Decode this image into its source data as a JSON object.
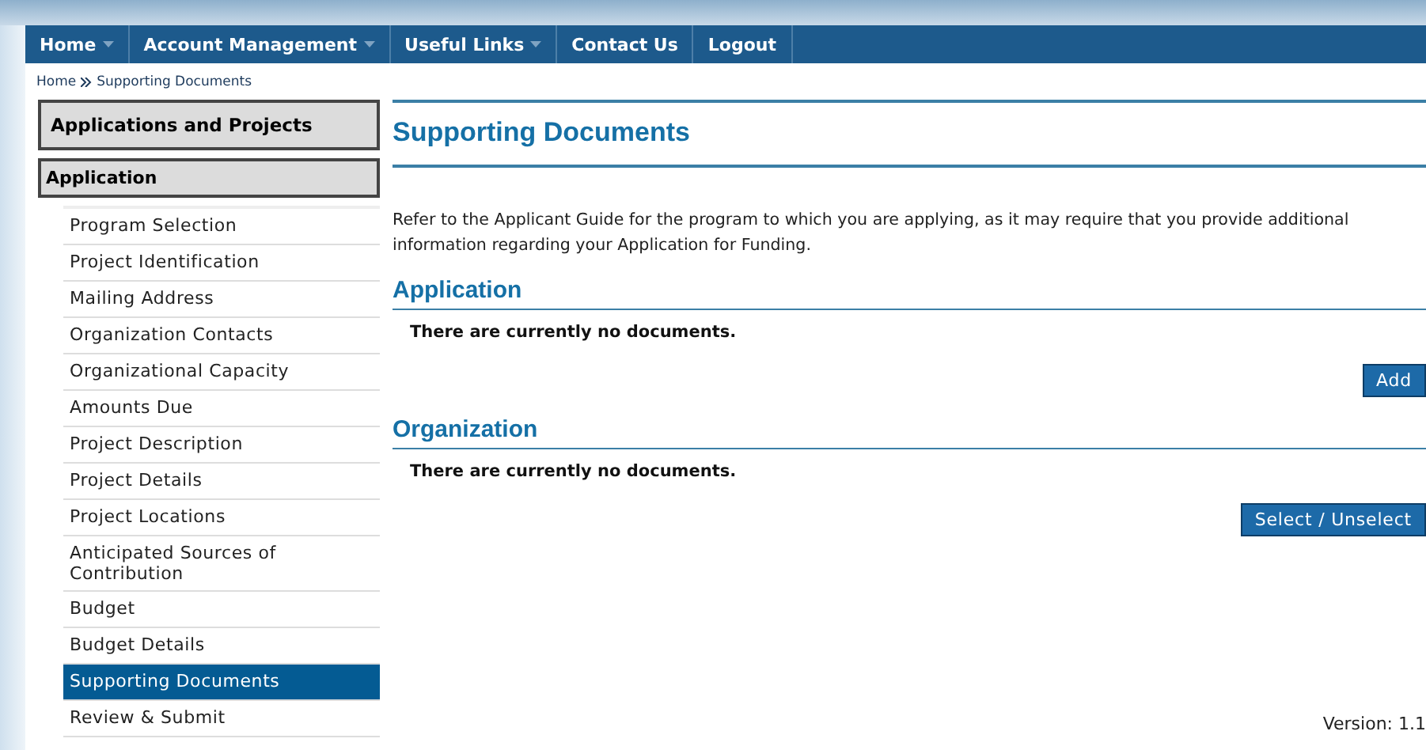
{
  "nav": [
    {
      "label": "Home",
      "has_menu": true
    },
    {
      "label": "Account Management",
      "has_menu": true
    },
    {
      "label": "Useful Links",
      "has_menu": true
    },
    {
      "label": "Contact Us",
      "has_menu": false
    },
    {
      "label": "Logout",
      "has_menu": false
    }
  ],
  "breadcrumb": [
    "Home",
    "Supporting Documents"
  ],
  "sidebar": {
    "headers": [
      "Applications and Projects",
      "Application"
    ],
    "items": [
      {
        "label": "Program Selection",
        "selected": false
      },
      {
        "label": "Project Identification",
        "selected": false
      },
      {
        "label": "Mailing Address",
        "selected": false
      },
      {
        "label": "Organization Contacts",
        "selected": false
      },
      {
        "label": "Organizational Capacity",
        "selected": false
      },
      {
        "label": "Amounts Due",
        "selected": false
      },
      {
        "label": "Project Description",
        "selected": false
      },
      {
        "label": "Project Details",
        "selected": false
      },
      {
        "label": "Project Locations",
        "selected": false
      },
      {
        "label": "Anticipated Sources of Contribution",
        "selected": false
      },
      {
        "label": "Budget",
        "selected": false
      },
      {
        "label": "Budget Details",
        "selected": false
      },
      {
        "label": "Supporting Documents",
        "selected": true
      },
      {
        "label": "Review & Submit",
        "selected": false
      }
    ]
  },
  "page_title": "Supporting Documents",
  "intro": "Refer to the Applicant Guide for the program to which you are applying, as it may require that you provide additional information regarding your Application for Funding.",
  "sections": [
    {
      "title": "Application",
      "empty_text": "There are currently no documents.",
      "button": "Add"
    },
    {
      "title": "Organization",
      "empty_text": "There are currently no documents.",
      "button": "Select / Unselect"
    }
  ],
  "version": "Version: 1.1"
}
